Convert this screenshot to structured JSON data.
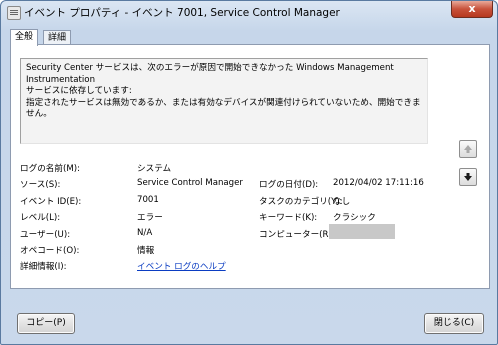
{
  "window": {
    "title": "イベント プロパティ - イベント 7001, Service Control Manager",
    "close_glyph": "x"
  },
  "tabs": [
    {
      "label": "全般",
      "selected": true
    },
    {
      "label": "詳細",
      "selected": false
    }
  ],
  "message": {
    "line1": "Security Center サービスは、次のエラーが原因で開始できなかった Windows Management Instrumentation",
    "line2": "サービスに依存しています:",
    "line3": "指定されたサービスは無効であるか、または有効なデバイスが関連付けられていないため、開始できません。"
  },
  "properties": {
    "log_name_label": "ログの名前(M):",
    "log_name_value": "システム",
    "source_label": "ソース(S):",
    "source_value": "Service Control Manager",
    "logged_label": "ログの日付(D):",
    "logged_value": "2012/04/02 17:11:16",
    "event_id_label": "イベント ID(E):",
    "event_id_value": "7001",
    "task_category_label": "タスクのカテゴリ(Y):",
    "task_category_value": "なし",
    "level_label": "レベル(L):",
    "level_value": "エラー",
    "keywords_label": "キーワード(K):",
    "keywords_value": "クラシック",
    "user_label": "ユーザー(U):",
    "user_value": "N/A",
    "computer_label": "コンピューター(R):",
    "opcode_label": "オペコード(O):",
    "opcode_value": "情報",
    "more_info_label": "詳細情報(I):",
    "more_info_link": "イベント ログのヘルプ"
  },
  "buttons": {
    "copy": "コピー(P)",
    "close": "閉じる(C)"
  },
  "icons": {
    "up": "arrow-up-icon",
    "down": "arrow-down-icon",
    "app": "event-viewer-icon"
  }
}
